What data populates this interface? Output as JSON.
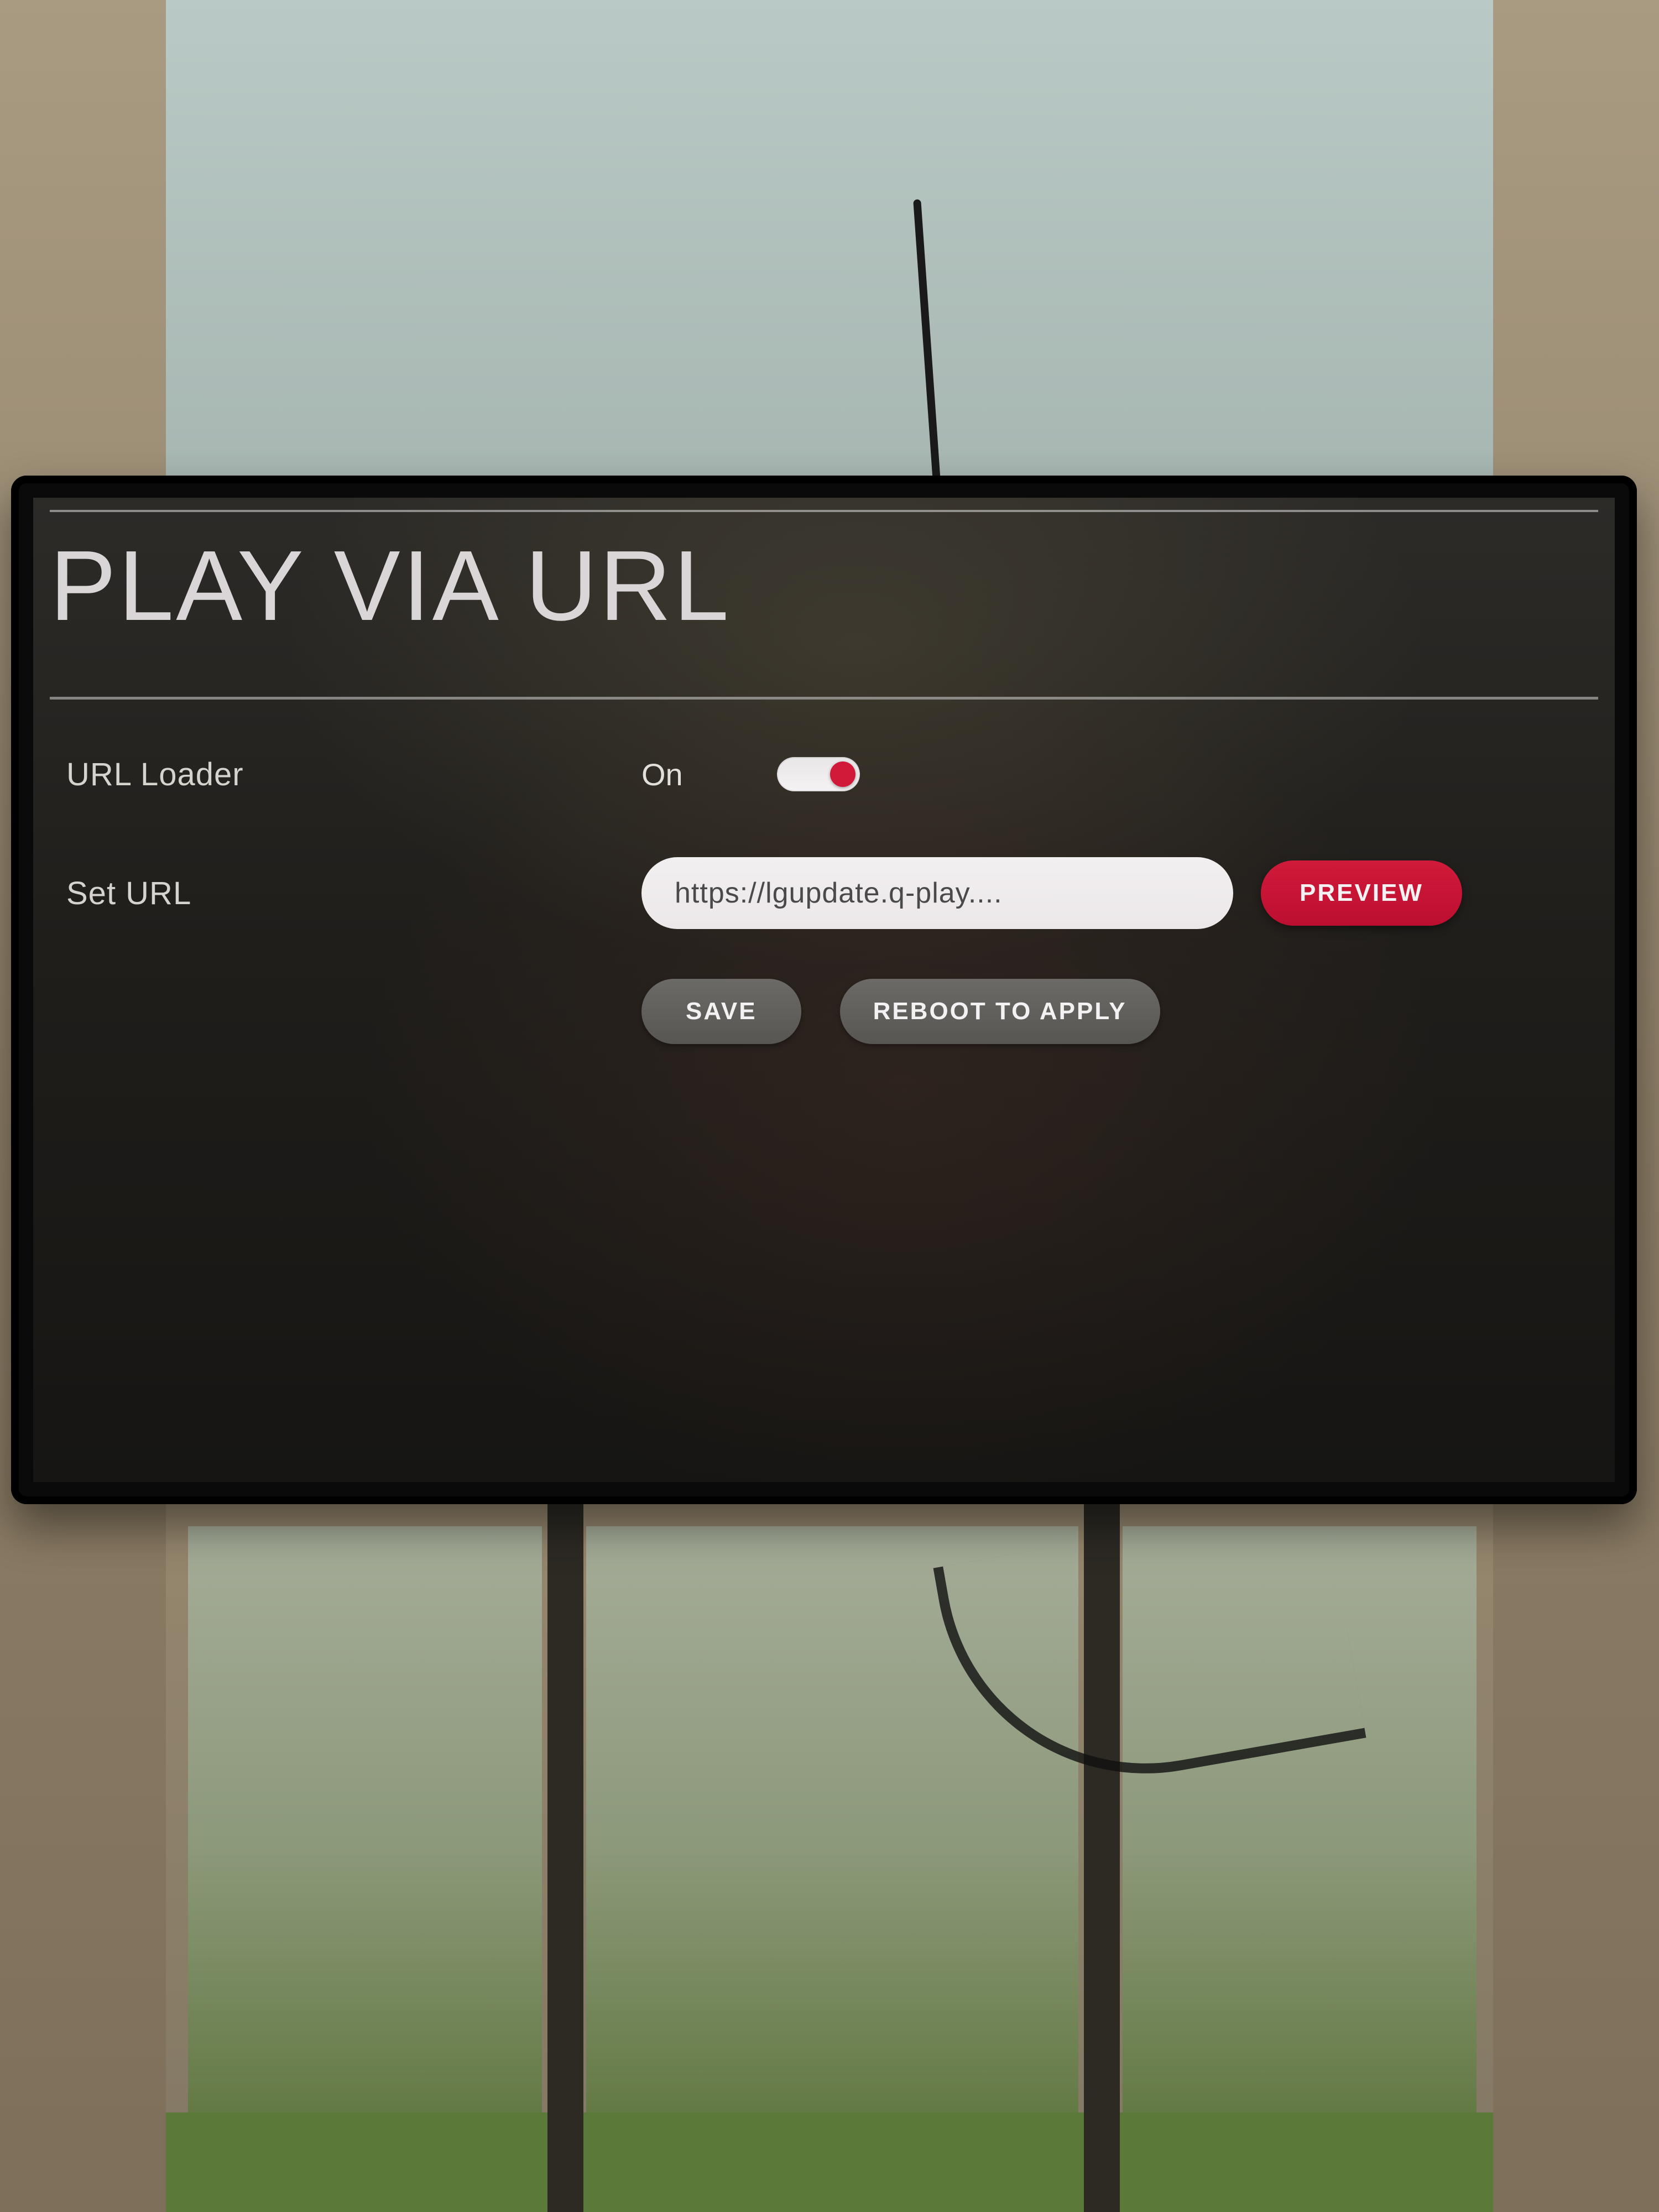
{
  "title": "PLAY VIA URL",
  "url_loader": {
    "label": "URL Loader",
    "state_label": "On",
    "state_on": true
  },
  "set_url": {
    "label": "Set URL",
    "value": "https://lgupdate.q-play....",
    "preview_label": "PREVIEW"
  },
  "actions": {
    "save_label": "SAVE",
    "reboot_label": "REBOOT TO APPLY"
  },
  "colors": {
    "accent_red": "#d11a3a",
    "button_grey": "#605e5a",
    "text_light": "#dad6d8"
  }
}
